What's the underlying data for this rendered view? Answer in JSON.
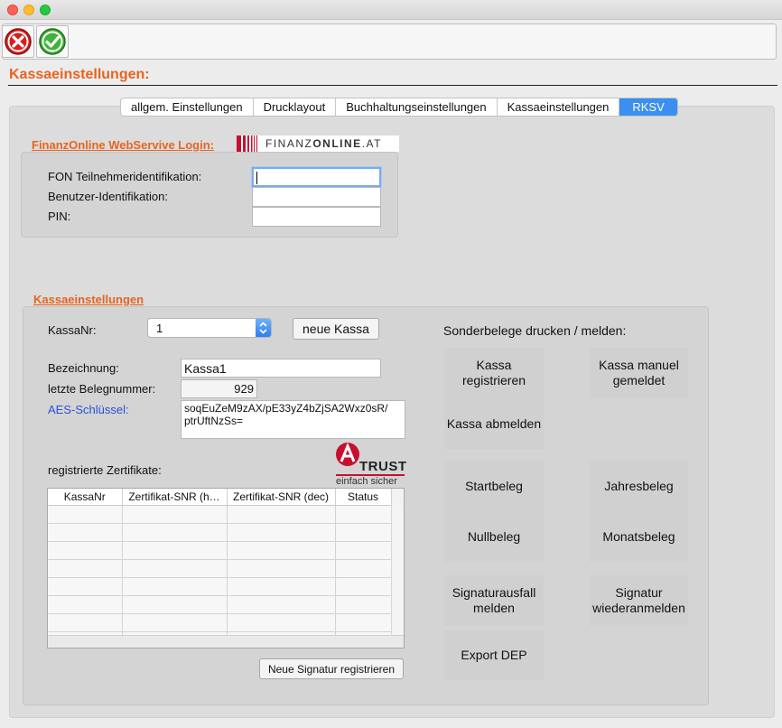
{
  "window": {
    "traffic_lights": [
      "#ff5f57",
      "#ffbd2e",
      "#28c940"
    ]
  },
  "toolbar": {
    "cancel_icon": "cancel-icon",
    "confirm_icon": "confirm-icon"
  },
  "page": {
    "title": "Kassaeinstellungen:"
  },
  "tabs": [
    {
      "label": "allgem. Einstellungen",
      "active": false
    },
    {
      "label": "Drucklayout",
      "active": false
    },
    {
      "label": "Buchhaltungseinstellungen",
      "active": false
    },
    {
      "label": "Kassaeinstellungen",
      "active": false
    },
    {
      "label": "RKSV",
      "active": true
    }
  ],
  "finanzonline": {
    "title": "FinanzOnline WebServive Login:",
    "logo_text_light": "FINANZ",
    "logo_text_bold": "ONLINE",
    "logo_text_suffix": ".AT",
    "fields": [
      {
        "label": "FON Teilnehmeridentifikation:",
        "value": ""
      },
      {
        "label": "Benutzer-Identifikation:",
        "value": ""
      },
      {
        "label": "PIN:",
        "value": ""
      }
    ]
  },
  "kassa": {
    "title": "Kassaeinstellungen",
    "kassanr_label": "KassaNr:",
    "kassanr_value": "1",
    "new_kassa_button": "neue Kassa",
    "bezeichnung_label": "Bezeichnung:",
    "bezeichnung_value": "Kassa1",
    "belegnummer_label": "letzte Belegnummer:",
    "belegnummer_value": "929",
    "aes_label": "AES-Schlüssel:",
    "aes_value_line1": "soqEuZeM9zAX/pE33yZ4bZjSA2Wxz0sR/",
    "aes_value_line2": "ptrUftNzSs=",
    "certs_label": "registrierte Zertifikate:",
    "atrust_brand": "TRUST",
    "atrust_tagline": "einfach sicher",
    "table_headers": [
      "KassaNr",
      "Zertifikat-SNR (h…",
      "Zertifikat-SNR (dec)",
      "Status"
    ],
    "new_signature_button": "Neue Signatur registrieren"
  },
  "sonderbelege": {
    "title": "Sonderbelege drucken / melden:",
    "kassa_registrieren": "Kassa\nregistrieren",
    "kassa_manuel": "Kassa manuel\ngemeldet",
    "kassa_abmelden": "Kassa abmelden",
    "startbeleg": "Startbeleg",
    "jahresbeleg": "Jahresbeleg",
    "nullbeleg": "Nullbeleg",
    "monatsbeleg": "Monatsbeleg",
    "signaturausfall": "Signaturausfall\nmelden",
    "signatur_wieder": "Signatur\nwiederanmelden",
    "export_dep": "Export DEP"
  },
  "colors": {
    "accent": "#e8641e",
    "tab_active": "#3a8ff0",
    "aes_label": "#2b4fd8"
  }
}
